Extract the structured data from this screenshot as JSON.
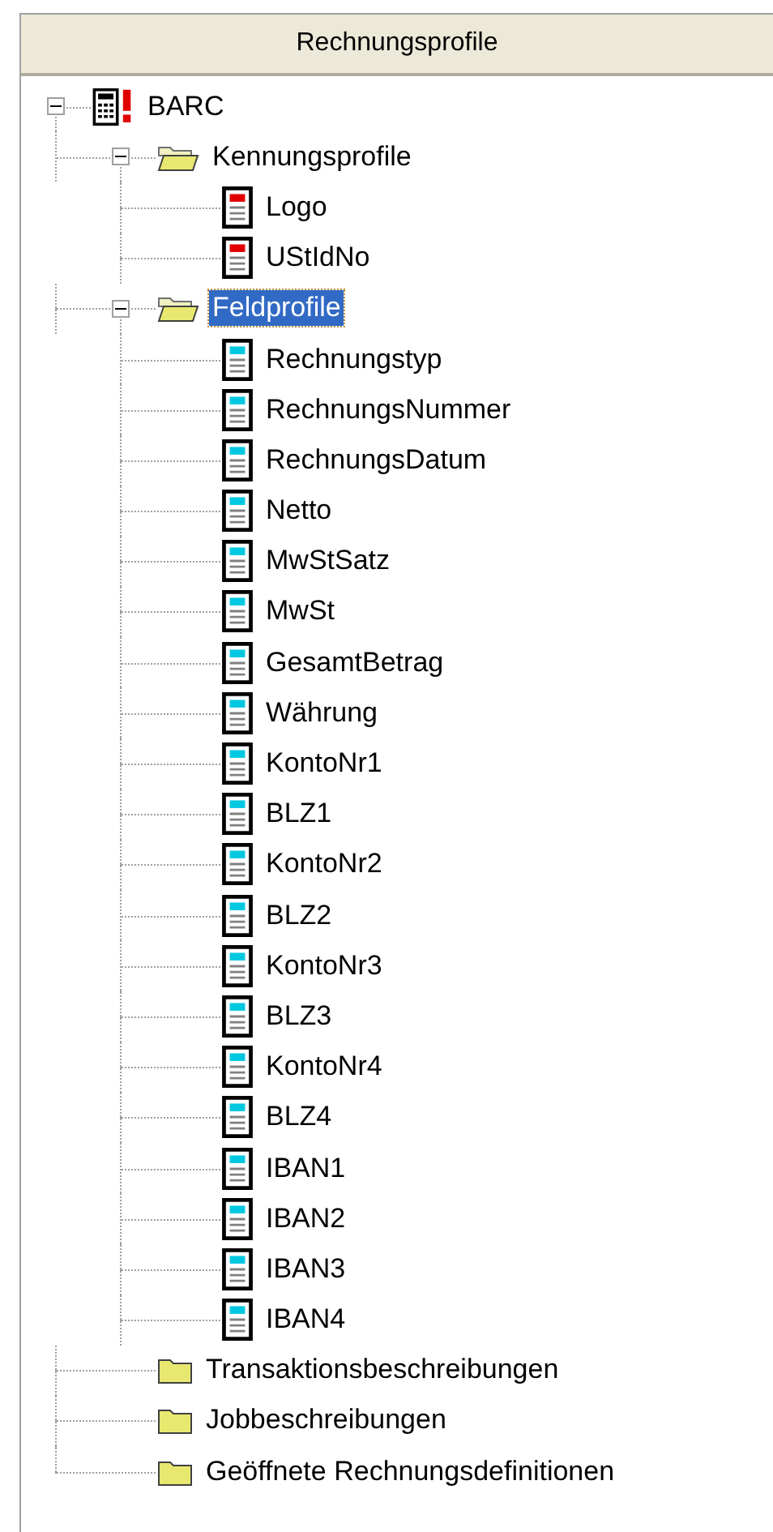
{
  "header": "Rechnungsprofile",
  "tree": [
    {
      "label": "BARC",
      "kind": "root",
      "expanded": true,
      "selected": false,
      "children": [
        {
          "label": "Kennungsprofile",
          "kind": "folder",
          "expanded": true,
          "selected": false,
          "children": [
            {
              "label": "Logo",
              "kind": "item",
              "color": "#e00000",
              "selected": false
            },
            {
              "label": "UStIdNo",
              "kind": "item",
              "color": "#e00000",
              "selected": false
            }
          ]
        },
        {
          "label": "Feldprofile",
          "kind": "folder",
          "expanded": true,
          "selected": true,
          "children": [
            {
              "label": "Rechnungstyp",
              "kind": "item",
              "color": "#00c8e0",
              "selected": false
            },
            {
              "label": "RechnungsNummer",
              "kind": "item",
              "color": "#00c8e0",
              "selected": false
            },
            {
              "label": "RechnungsDatum",
              "kind": "item",
              "color": "#00c8e0",
              "selected": false
            },
            {
              "label": "Netto",
              "kind": "item",
              "color": "#00c8e0",
              "selected": false
            },
            {
              "label": "MwStSatz",
              "kind": "item",
              "color": "#00c8e0",
              "selected": false
            },
            {
              "label": "MwSt",
              "kind": "item",
              "color": "#00c8e0",
              "selected": false
            },
            {
              "label": "GesamtBetrag",
              "kind": "item",
              "color": "#00c8e0",
              "selected": false
            },
            {
              "label": "Währung",
              "kind": "item",
              "color": "#00c8e0",
              "selected": false
            },
            {
              "label": "KontoNr1",
              "kind": "item",
              "color": "#00c8e0",
              "selected": false
            },
            {
              "label": "BLZ1",
              "kind": "item",
              "color": "#00c8e0",
              "selected": false
            },
            {
              "label": "KontoNr2",
              "kind": "item",
              "color": "#00c8e0",
              "selected": false
            },
            {
              "label": "BLZ2",
              "kind": "item",
              "color": "#00c8e0",
              "selected": false
            },
            {
              "label": "KontoNr3",
              "kind": "item",
              "color": "#00c8e0",
              "selected": false
            },
            {
              "label": "BLZ3",
              "kind": "item",
              "color": "#00c8e0",
              "selected": false
            },
            {
              "label": "KontoNr4",
              "kind": "item",
              "color": "#00c8e0",
              "selected": false
            },
            {
              "label": "BLZ4",
              "kind": "item",
              "color": "#00c8e0",
              "selected": false
            },
            {
              "label": "IBAN1",
              "kind": "item",
              "color": "#00c8e0",
              "selected": false
            },
            {
              "label": "IBAN2",
              "kind": "item",
              "color": "#00c8e0",
              "selected": false
            },
            {
              "label": "IBAN3",
              "kind": "item",
              "color": "#00c8e0",
              "selected": false
            },
            {
              "label": "IBAN4",
              "kind": "item",
              "color": "#00c8e0",
              "selected": false
            }
          ]
        },
        {
          "label": "Transaktionsbeschreibungen",
          "kind": "folder",
          "expanded": false,
          "selected": false
        },
        {
          "label": "Jobbeschreibungen",
          "kind": "folder",
          "expanded": false,
          "selected": false
        },
        {
          "label": "Geöffnete Rechnungsdefinitionen",
          "kind": "folder",
          "expanded": false,
          "selected": false
        }
      ]
    }
  ]
}
